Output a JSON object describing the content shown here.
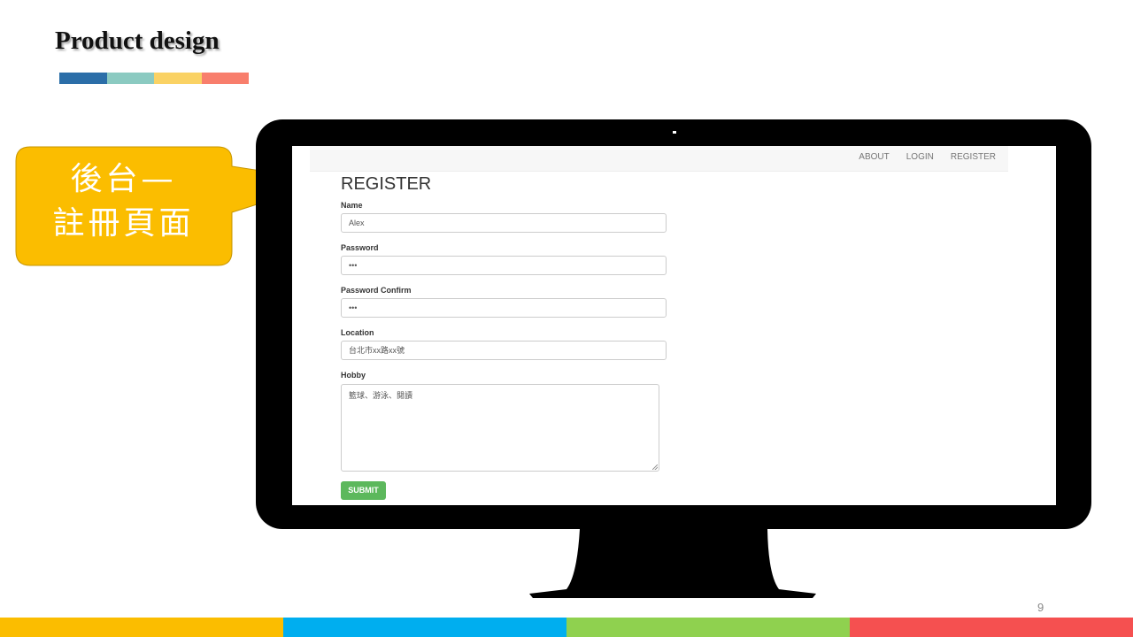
{
  "slide": {
    "title": "Product design",
    "title_bar_colors": [
      "#2b6ea8",
      "#8bcac1",
      "#fad264",
      "#f87e6c"
    ],
    "callout_color": "#fbbd00",
    "callout_line1": "後台—",
    "callout_line2": "註冊頁面",
    "page_number": "9",
    "footer_colors": [
      "#fbbd00",
      "#00aeef",
      "#8fd14f",
      "#f55050"
    ]
  },
  "app": {
    "nav": {
      "about": "ABOUT",
      "login": "LOGIN",
      "register": "REGISTER"
    },
    "form": {
      "title": "REGISTER",
      "name_label": "Name",
      "name_value": "Alex",
      "password_label": "Password",
      "password_value": "•••",
      "password_confirm_label": "Password Confirm",
      "password_confirm_value": "•••",
      "location_label": "Location",
      "location_value": "台北市xx路xx號",
      "hobby_label": "Hobby",
      "hobby_value": "籃球、游泳、閱讀",
      "submit_label": "SUBMIT",
      "submit_color": "#5cb85c"
    }
  }
}
